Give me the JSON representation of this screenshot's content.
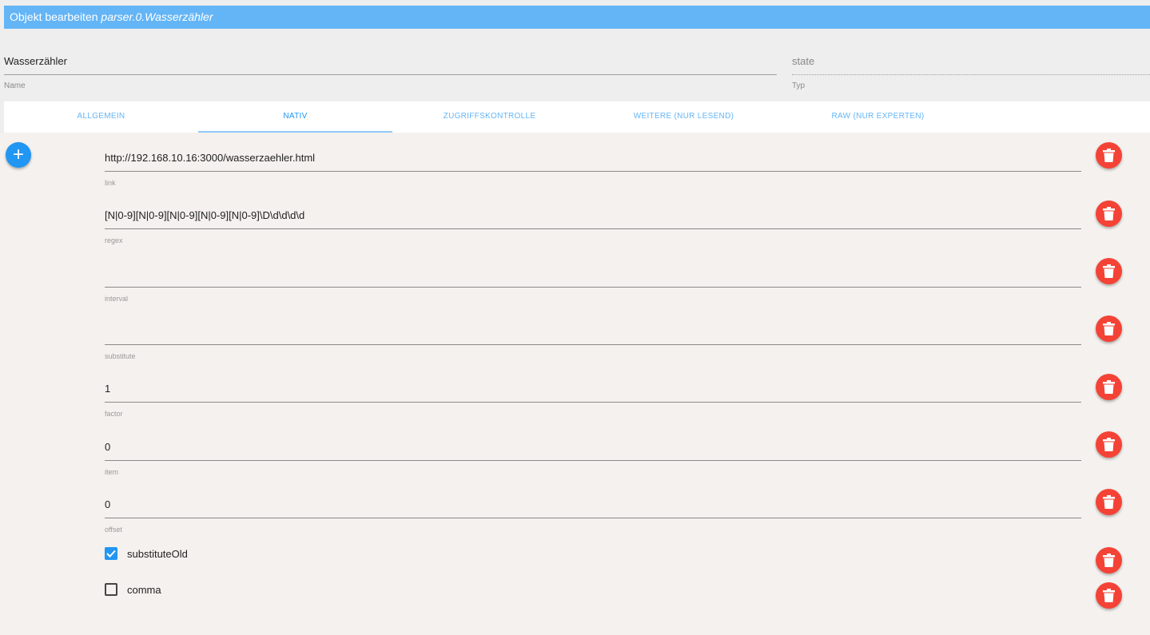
{
  "dialog": {
    "title_prefix": "Objekt bearbeiten",
    "title_object": "parser.0.Wasserzähler"
  },
  "header": {
    "name_value": "Wasserzähler",
    "name_label": "Name",
    "type_value": "state",
    "type_label": "Typ"
  },
  "tabs": [
    {
      "label": "ALLGEMEIN",
      "active": false
    },
    {
      "label": "NATIV",
      "active": true
    },
    {
      "label": "ZUGRIFFSKONTROLLE",
      "active": false
    },
    {
      "label": "WEITERE (NUR LESEND)",
      "active": false
    },
    {
      "label": "RAW (NUR EXPERTEN)",
      "active": false
    }
  ],
  "native": {
    "add_icon": "plus-icon",
    "delete_icon": "trash-icon",
    "fields": [
      {
        "label": "link",
        "value": "http://192.168.10.16:3000/wasserzaehler.html"
      },
      {
        "label": "regex",
        "value": "[N|0-9][N|0-9][N|0-9][N|0-9][N|0-9]\\D\\d\\d\\d\\d"
      },
      {
        "label": "interval",
        "value": ""
      },
      {
        "label": "substitute",
        "value": ""
      },
      {
        "label": "factor",
        "value": "1"
      },
      {
        "label": "item",
        "value": "0"
      },
      {
        "label": "offset",
        "value": "0"
      }
    ],
    "checkboxes": [
      {
        "label": "substituteOld",
        "checked": true
      },
      {
        "label": "comma",
        "checked": false
      }
    ]
  },
  "colors": {
    "title_bar": "#64b5f6",
    "tab_text": "#64b5f6",
    "active_tab": "#2196f3",
    "add_button": "#2196f3",
    "delete_button": "#f44336",
    "checkbox_checked": "#2196f3"
  }
}
